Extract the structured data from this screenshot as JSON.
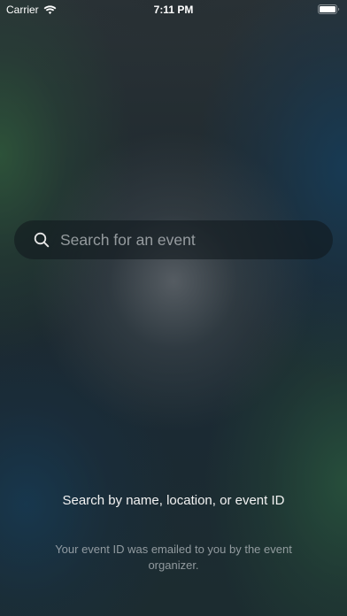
{
  "status_bar": {
    "carrier": "Carrier",
    "time": "7:11 PM",
    "wifi_icon": "wifi-icon",
    "battery_icon": "battery-full-icon"
  },
  "search": {
    "placeholder": "Search for an event",
    "value": "",
    "icon": "search-icon"
  },
  "hint": {
    "title": "Search by name, location, or event ID",
    "subtitle": "Your event ID was emailed to you by the event organizer."
  }
}
